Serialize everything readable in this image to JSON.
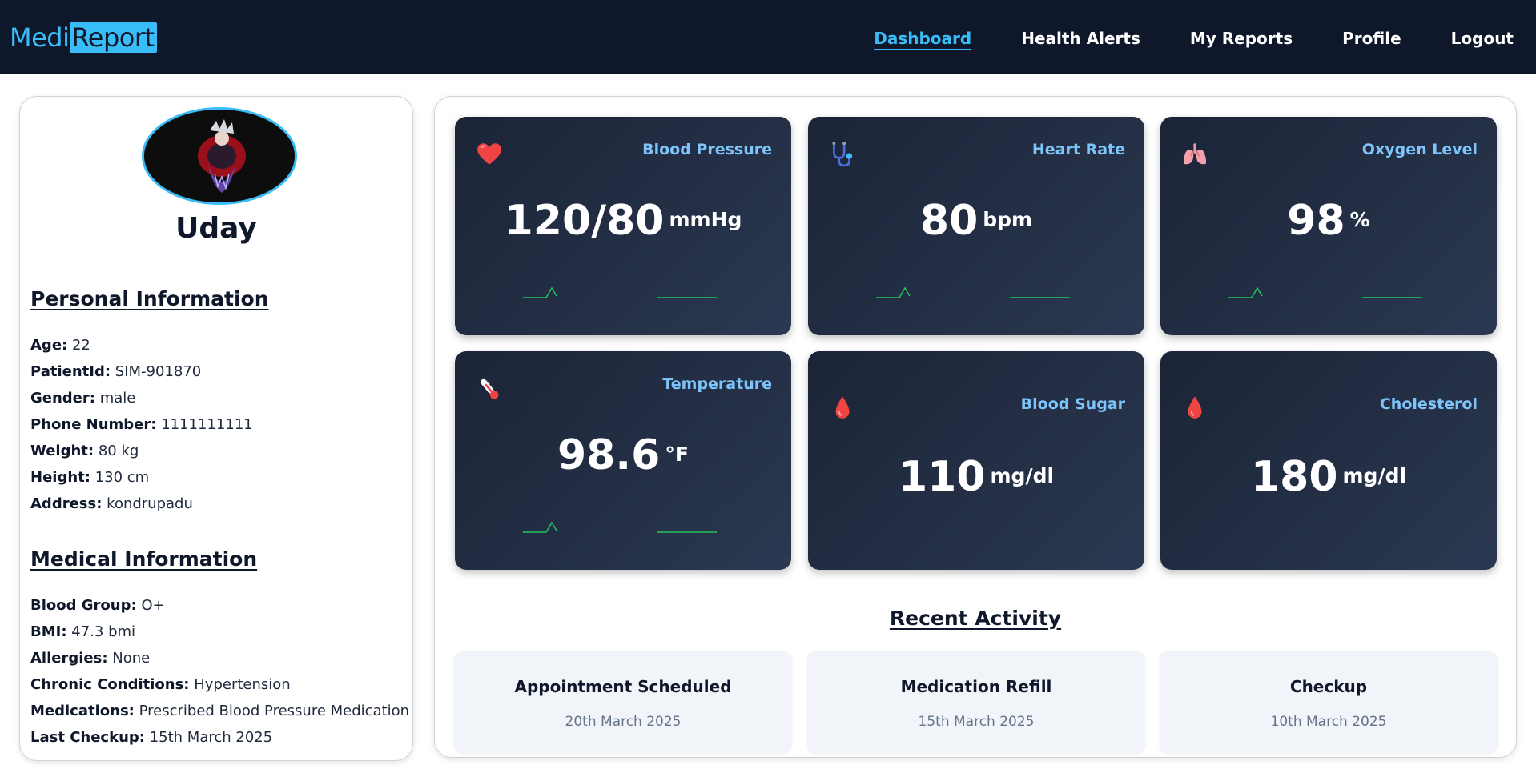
{
  "brand": {
    "part1": "Medi",
    "part2": "Report"
  },
  "nav": {
    "items": [
      {
        "label": "Dashboard",
        "active": true
      },
      {
        "label": "Health Alerts",
        "active": false
      },
      {
        "label": "My Reports",
        "active": false
      },
      {
        "label": "Profile",
        "active": false
      },
      {
        "label": "Logout",
        "active": false
      }
    ]
  },
  "profile": {
    "name": "Uday",
    "personal_title": "Personal Information",
    "personal": [
      {
        "label": "Age:",
        "value": "22"
      },
      {
        "label": "PatientId:",
        "value": "SIM-901870"
      },
      {
        "label": "Gender:",
        "value": "male"
      },
      {
        "label": "Phone Number:",
        "value": "1111111111"
      },
      {
        "label": "Weight:",
        "value": "80 kg"
      },
      {
        "label": "Height:",
        "value": "130 cm"
      },
      {
        "label": "Address:",
        "value": "kondrupadu"
      }
    ],
    "medical_title": "Medical Information",
    "medical": [
      {
        "label": "Blood Group:",
        "value": "O+"
      },
      {
        "label": "BMI:",
        "value": "47.3 bmi"
      },
      {
        "label": "Allergies:",
        "value": "None"
      },
      {
        "label": "Chronic Conditions:",
        "value": "Hypertension"
      },
      {
        "label": "Medications:",
        "value": "Prescribed Blood Pressure Medication"
      },
      {
        "label": "Last Checkup:",
        "value": "15th March 2025"
      }
    ]
  },
  "metrics": [
    {
      "title": "Blood Pressure",
      "value": "120/80",
      "unit": "mmHg",
      "icon": "heart-icon",
      "trend": true
    },
    {
      "title": "Heart Rate",
      "value": "80",
      "unit": "bpm",
      "icon": "stethoscope-icon",
      "trend": true
    },
    {
      "title": "Oxygen Level",
      "value": "98",
      "unit": "%",
      "icon": "lungs-icon",
      "trend": true
    },
    {
      "title": "Temperature",
      "value": "98.6",
      "unit": "°F",
      "icon": "thermometer-icon",
      "trend": true
    },
    {
      "title": "Blood Sugar",
      "value": "110",
      "unit": "mg/dl",
      "icon": "blood-drop-icon",
      "trend": false
    },
    {
      "title": "Cholesterol",
      "value": "180",
      "unit": "mg/dl",
      "icon": "blood-drop-icon",
      "trend": false
    }
  ],
  "colors": {
    "nav_bg": "#0f172a",
    "accent": "#38bdf8",
    "card_bg": "#1e293b",
    "metric_title": "#7cc4fa",
    "trend_green": "#22c55e",
    "drop_red": "#ef4444"
  },
  "recent_activity": {
    "title": "Recent Activity",
    "items": [
      {
        "title": "Appointment Scheduled",
        "date": "20th March 2025"
      },
      {
        "title": "Medication Refill",
        "date": "15th March 2025"
      },
      {
        "title": "Checkup",
        "date": "10th March 2025"
      }
    ]
  }
}
